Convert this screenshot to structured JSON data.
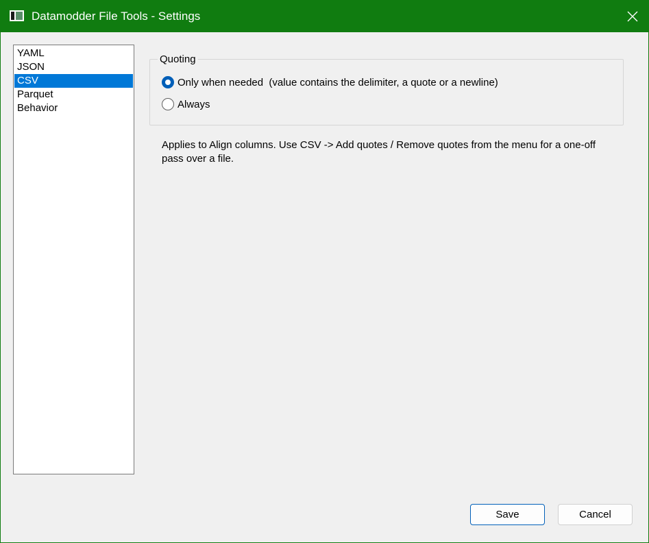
{
  "window": {
    "title": "Datamodder File Tools - Settings",
    "accent_color": "#107c10",
    "icon": "app-window-icon",
    "close_icon": "close-icon"
  },
  "sidebar": {
    "items": [
      {
        "label": "YAML",
        "selected": false
      },
      {
        "label": "JSON",
        "selected": false
      },
      {
        "label": "CSV",
        "selected": true
      },
      {
        "label": "Parquet",
        "selected": false
      },
      {
        "label": "Behavior",
        "selected": false
      }
    ],
    "selected_color": "#0078d7"
  },
  "quoting": {
    "legend": "Quoting",
    "options": [
      {
        "label": "Only when needed  (value contains the delimiter, a quote or a newline)",
        "checked": true
      },
      {
        "label": "Always",
        "checked": false
      }
    ]
  },
  "note": "Applies to Align columns. Use CSV -> Add quotes / Remove quotes from the menu for a one-off pass over a file.",
  "buttons": {
    "save_label": "Save",
    "cancel_label": "Cancel"
  }
}
